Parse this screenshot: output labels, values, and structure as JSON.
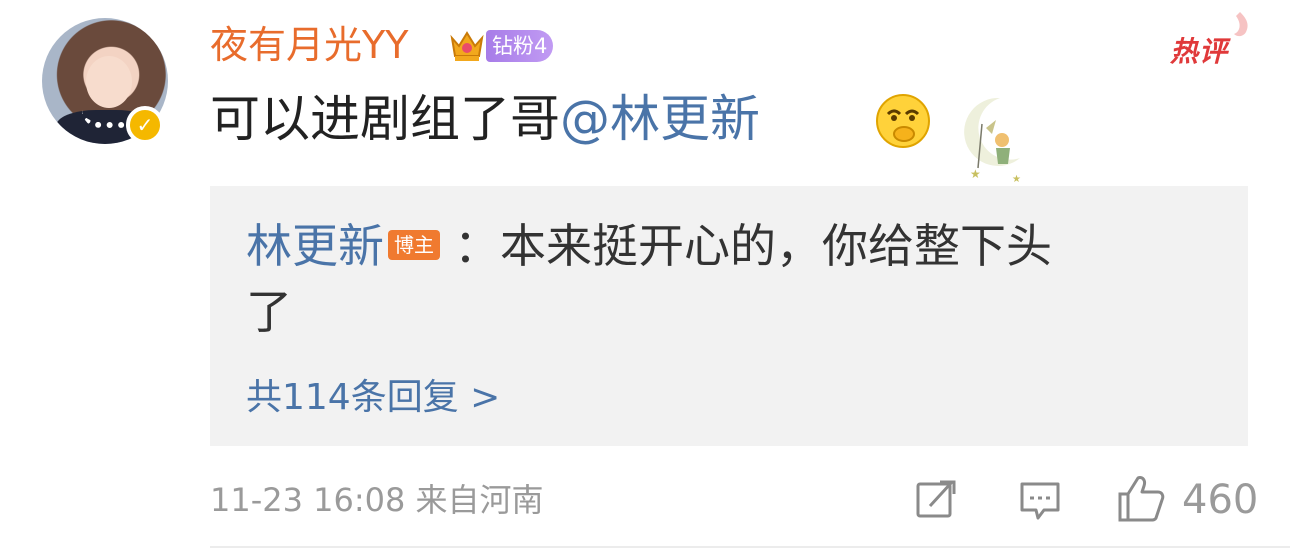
{
  "comment": {
    "username": "夜有月光YY",
    "fan_badge": "钻粉4",
    "hot_label": "热评",
    "text_prefix": "可以进剧组了哥",
    "mention": "@林更新",
    "reply": {
      "author": "林更新",
      "author_badge": "博主",
      "text_line1": "：本来挺开心的，你给整下头",
      "text_line2": "了",
      "more": "共114条回复 >"
    },
    "meta": "11-23 16:08 来自河南",
    "like_count": "460"
  },
  "icons": {
    "verified": "verified-badge-icon",
    "crown": "crown-icon",
    "emoji": "thinking-emoji-icon",
    "share": "share-icon",
    "comment": "comment-icon",
    "like": "thumbs-up-icon"
  },
  "colors": {
    "username": "#e86c2c",
    "mention": "#4a74a8",
    "hot": "#e0393a",
    "fan_badge": "#b48cf0",
    "blogger_badge": "#f07a2f",
    "reply_bg": "#f2f2f2"
  }
}
